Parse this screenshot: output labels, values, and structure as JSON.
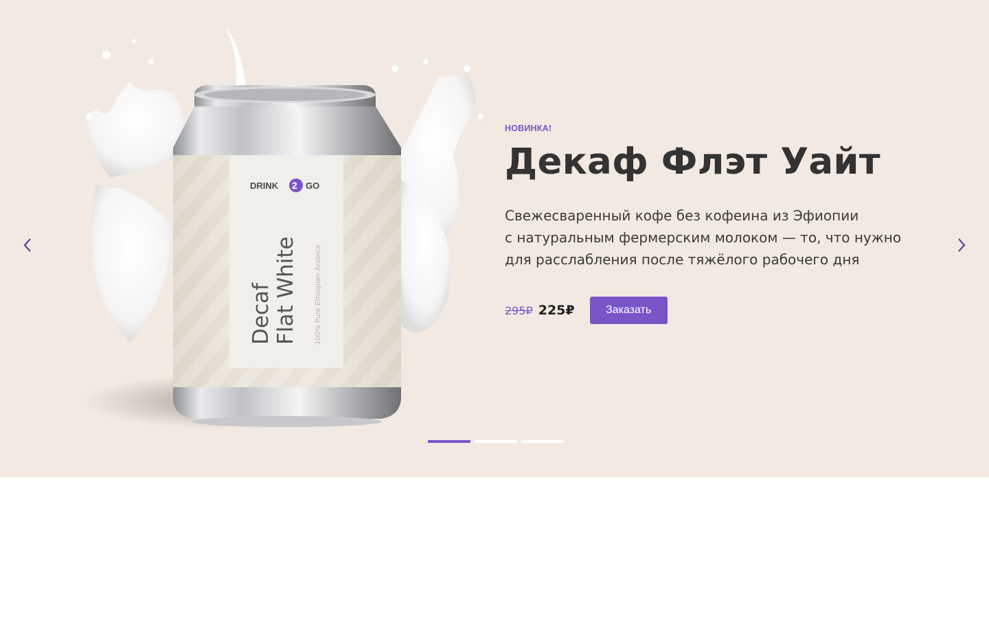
{
  "slider": {
    "badge": "НОВИНКА!",
    "title": "Декаф Флэт Уайт",
    "description_lines": [
      "Свежесваренный кофе без кофеина из Эфиопии",
      "с натуральным фермерским молоком — то, что нужно",
      "для расслабления после тяжёлого рабочего дня"
    ],
    "old_price": "295₽",
    "new_price": "225₽",
    "order_label": "Заказать",
    "active_slide": 1,
    "slide_count": 3
  },
  "product": {
    "brand_left": "DRINK",
    "brand_mid": "2",
    "brand_right": "GO",
    "name_line1": "Decaf",
    "name_line2": "Flat White",
    "subtitle": "100% Pure Ethiopian Arabica"
  },
  "colors": {
    "accent": "#7a55c8",
    "background": "#f2eae2",
    "text": "#333333"
  },
  "icons": {
    "prev": "chevron-left-icon",
    "next": "chevron-right-icon"
  }
}
